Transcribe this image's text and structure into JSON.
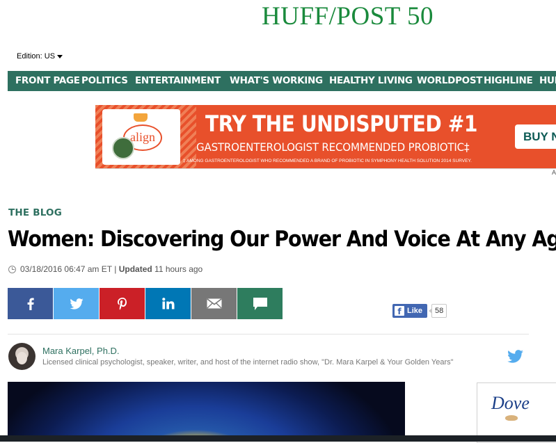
{
  "logo": {
    "text": "HUFF/POST 50"
  },
  "edition": {
    "label": "Edition: US"
  },
  "nav": {
    "items": [
      {
        "label": "FRONT PAGE"
      },
      {
        "label": "POLITICS"
      },
      {
        "label": "ENTERTAINMENT"
      },
      {
        "label": "WHAT'S WORKING"
      },
      {
        "label": "HEALTHY LIVING"
      },
      {
        "label": "WORLDPOST"
      },
      {
        "label": "HIGHLINE"
      },
      {
        "label": "HUF"
      }
    ]
  },
  "ad": {
    "brand": "align",
    "headline": "TRY THE UNDISPUTED #1",
    "subhead": "GASTROENTEROLOGIST RECOMMENDED PROBIOTIC‡",
    "fineprint": "‡ AMONG GASTROENTEROLOGIST WHO RECOMMENDED A BRAND OF PROBIOTIC IN SYMPHONY HEALTH SOLUTION 2014 SURVEY.",
    "cta": "BUY N",
    "choices_marker": "A",
    "colors": {
      "background": "#e8502b",
      "cta_text": "#0d5b55"
    }
  },
  "article": {
    "section": "THE BLOG",
    "title": "Women: Discovering Our Power And Voice At Any Age",
    "date": "03/18/2016 06:47 am ET",
    "separator": "|",
    "updated_label": "Updated",
    "updated_value": "11 hours ago"
  },
  "share": {
    "buttons": [
      {
        "icon": "facebook-icon",
        "color": "#3b5998"
      },
      {
        "icon": "twitter-icon",
        "color": "#55acee"
      },
      {
        "icon": "pinterest-icon",
        "color": "#cb2027"
      },
      {
        "icon": "linkedin-icon",
        "color": "#0077b5"
      },
      {
        "icon": "email-icon",
        "color": "#777777"
      },
      {
        "icon": "comment-icon",
        "color": "#2e7d5e"
      }
    ],
    "facebook_like": {
      "label": "Like",
      "count": "58"
    }
  },
  "author": {
    "name": "Mara Karpel, Ph.D.",
    "bio": "Licensed clinical psychologist, speaker, writer, and host of the internet radio show, \"Dr. Mara Karpel & Your Golden Years\""
  },
  "side_ad": {
    "brand": "Dove"
  },
  "theme": {
    "brand_green": "#2e7060",
    "logo_green": "#1a8a3c"
  }
}
